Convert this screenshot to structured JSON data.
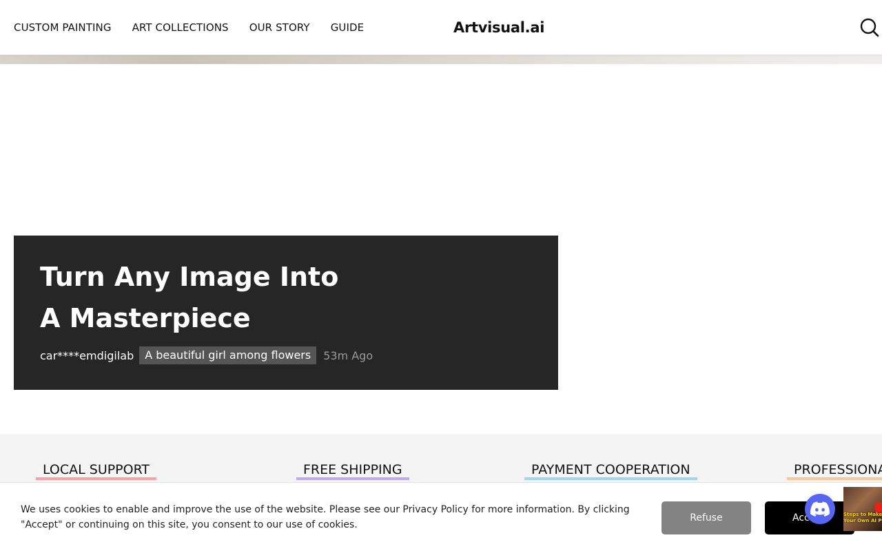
{
  "header": {
    "nav": [
      {
        "label": "CUSTOM PAINTING"
      },
      {
        "label": "ART COLLECTIONS"
      },
      {
        "label": "OUR STORY"
      },
      {
        "label": "GUIDE"
      }
    ],
    "logo": "Artvisual.ai",
    "search_icon": "search-icon"
  },
  "banner": {
    "title_line1": "Turn Any Image Into",
    "title_line2": "A Masterpiece",
    "user": "car****emdigilab",
    "tag": "A beautiful girl among flowers",
    "time": "53m Ago"
  },
  "features": [
    {
      "label": "LOCAL SUPPORT",
      "color": "#f7a1a1"
    },
    {
      "label": "FREE SHIPPING",
      "color": "#c3a6f5"
    },
    {
      "label": "PAYMENT COOPERATION",
      "color": "#9fd3f7"
    },
    {
      "label": "PROFESSIONA",
      "color": "#f9c59a"
    }
  ],
  "cookie": {
    "text": "We uses cookies to enable and improve the use of the website. Please see our Privacy Policy for more information. By clicking \"Accept\" or continuing on this site, you consent to our use of cookies.",
    "refuse_label": "Refuse",
    "accept_label": "Acc"
  },
  "floating": {
    "discord_icon": "discord-icon",
    "video_caption_1": "Steps to Make",
    "video_caption_2": "Your Own AI Port"
  },
  "colors": {
    "banner_bg": "#262626",
    "tag_bg": "#555555",
    "features_bg": "#f4f4f4",
    "refuse_bg": "#838383",
    "accept_bg": "#000000",
    "discord": "#5865f2"
  }
}
